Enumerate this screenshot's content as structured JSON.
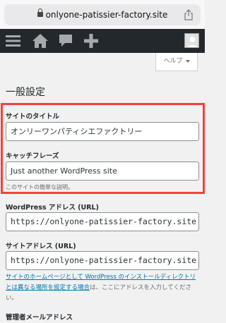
{
  "browser": {
    "url": "onlyone-patissier-factory.site"
  },
  "admin_bar": {
    "icons": [
      "menu-icon",
      "home-icon",
      "comment-icon",
      "add-new-icon"
    ]
  },
  "help_tab": {
    "label": "ヘルプ"
  },
  "page": {
    "title": "一般設定"
  },
  "fields": {
    "site_title": {
      "label": "サイトのタイトル",
      "value": "オンリーワンパティシエファクトリー"
    },
    "tagline": {
      "label": "キャッチフレーズ",
      "value": "Just another WordPress site",
      "hint": "このサイトの簡単な説明。"
    },
    "wp_address": {
      "label": "WordPress アドレス (URL)",
      "value": "https://onlyone-patissier-factory.site"
    },
    "site_address": {
      "label": "サイトアドレス (URL)",
      "value": "https://onlyone-patissier-factory.site",
      "desc_link": "サイトのホームページとして WordPress のインストールディレクトリとは異なる場所を設定する場合",
      "desc_rest": "は、ここにアドレスを入力してください。"
    },
    "admin_email": {
      "label": "管理者メールアドレス"
    }
  },
  "colors": {
    "highlight": "#f5413e",
    "admin_bar": "#23282d",
    "link": "#0073aa"
  }
}
